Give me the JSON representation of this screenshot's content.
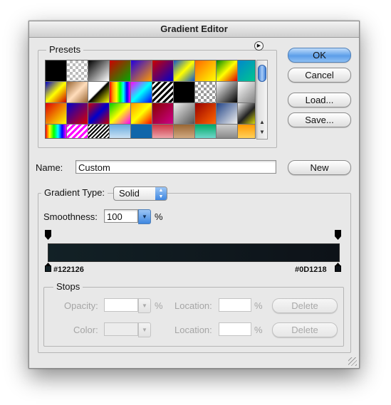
{
  "window": {
    "title": "Gradient Editor"
  },
  "presets": {
    "label": "Presets",
    "menu_icon": "play-circle-icon",
    "swatches": [
      "linear-gradient(#000,#000)",
      "repeating-conic-gradient(#bbb 0 25%, #fff 0 50%) 0 0/8px 8px",
      "linear-gradient(135deg,#000,#fff)",
      "linear-gradient(135deg,#c00,#0a0)",
      "linear-gradient(135deg,#20d,#f90)",
      "linear-gradient(135deg,#c00,#00c)",
      "linear-gradient(135deg,#15c,#ff0 50%,#15c)",
      "linear-gradient(135deg,#f60,#ff0)",
      "linear-gradient(135deg,#080,#ff0 50%,#d00)",
      "linear-gradient(135deg,#08c,#0c8)",
      "linear-gradient(135deg,#00c,#ff0 50%,#c00)",
      "linear-gradient(135deg,#963,#fdb 50%,#963)",
      "linear-gradient(135deg,#fff 45%,#000 50%,#ff0)",
      "linear-gradient(90deg,red,orange,yellow,lime,cyan,blue,magenta)",
      "linear-gradient(135deg,#f0f,#0ff 50%,#00f)",
      "repeating-linear-gradient(135deg,#000 0 3px,#fff 3px 6px)",
      "linear-gradient(#000,#000)",
      "repeating-conic-gradient(#999 0 25%, #fff 0 50%) 0 0/8px 8px",
      "linear-gradient(135deg,#fff,#000)",
      "linear-gradient(135deg,#fff,#777)",
      "linear-gradient(135deg,#d00,#ff0)",
      "linear-gradient(135deg,#00c,#d00)",
      "linear-gradient(135deg,#c00,#00c 50%,#c00)",
      "linear-gradient(135deg,#0c0,#ff0 50%,#f0f)",
      "linear-gradient(135deg,#f90,#ff0 50%,#f00)",
      "linear-gradient(135deg,#800,#c08)",
      "linear-gradient(135deg,#eee,#555)",
      "linear-gradient(135deg,#900,#f60)",
      "linear-gradient(135deg,#248,#eee)",
      "linear-gradient(135deg,#eee,#222 50%,#ff0)",
      "linear-gradient(90deg,red,yellow,lime,cyan,blue,magenta)",
      "repeating-linear-gradient(135deg,#f0f 0 3px,#fff 3px 6px)",
      "repeating-linear-gradient(135deg,#000 0 2px,#fff 2px 4px)",
      "linear-gradient(#6ad,#fff)",
      "linear-gradient(#16a,#16a)",
      "linear-gradient(#c34,#fdd)",
      "linear-gradient(#963,#eca)",
      "linear-gradient(#0a6,#aef)",
      "linear-gradient(#ccc,#666)",
      "linear-gradient(#f90,#fe8)"
    ]
  },
  "buttons": {
    "ok": "OK",
    "cancel": "Cancel",
    "load": "Load...",
    "save": "Save...",
    "new": "New",
    "delete_opacity": "Delete",
    "delete_color": "Delete"
  },
  "name": {
    "label": "Name:",
    "value": "Custom"
  },
  "gradient": {
    "type_label": "Gradient Type:",
    "type_value": "Solid",
    "smoothness_label": "Smoothness:",
    "smoothness_value": "100",
    "smoothness_unit": "%",
    "start_color": "#122126",
    "end_color": "#0D1218",
    "start_label": "#122126",
    "end_label": "#0D1218"
  },
  "stops": {
    "label": "Stops",
    "opacity_label": "Opacity:",
    "opacity_value": "",
    "opacity_unit": "%",
    "opacity_location_label": "Location:",
    "opacity_location_value": "",
    "opacity_location_unit": "%",
    "color_label": "Color:",
    "color_location_label": "Location:",
    "color_location_value": "",
    "color_location_unit": "%"
  }
}
